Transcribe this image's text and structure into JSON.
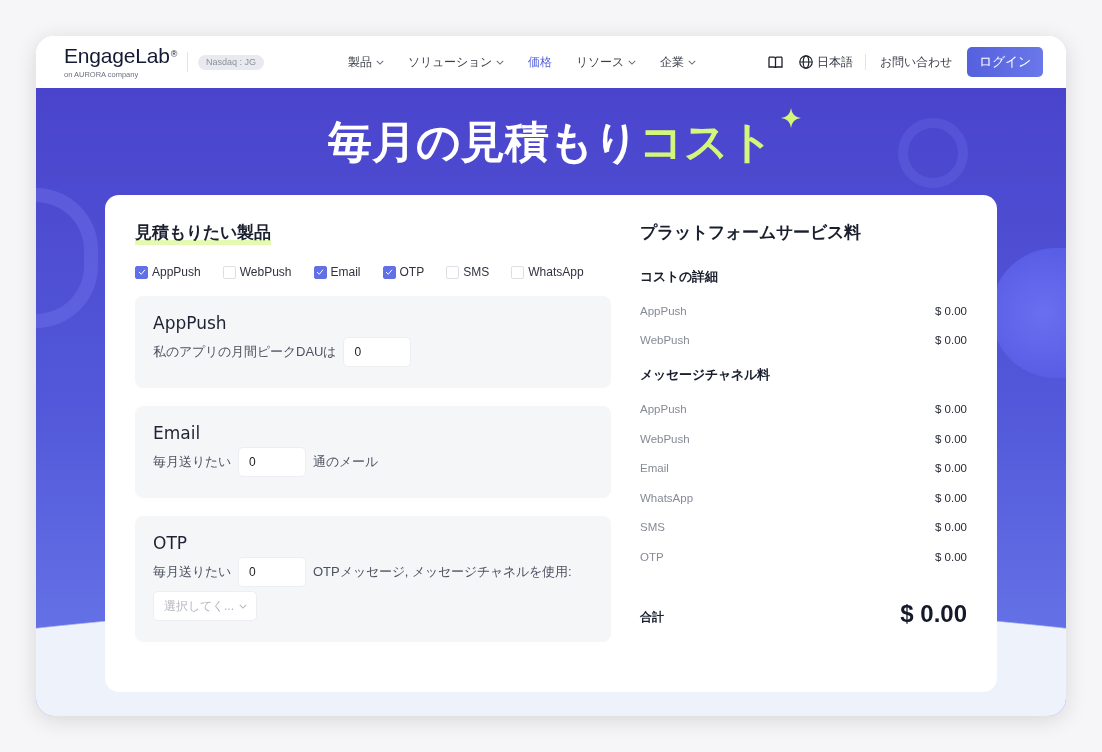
{
  "header": {
    "logo": {
      "wordmark": "EngageLab$^{®}$",
      "tagline": "on AURORA company"
    },
    "stock_badge": "Nasdaq : JG",
    "nav": [
      {
        "label": "製品",
        "dropdown": true,
        "selected": false
      },
      {
        "label": "ソリューション",
        "dropdown": true,
        "selected": false
      },
      {
        "label": "価格",
        "dropdown": false,
        "selected": true
      },
      {
        "label": "リソース",
        "dropdown": true,
        "selected": false
      },
      {
        "label": "企業",
        "dropdown": true,
        "selected": false
      }
    ],
    "language": "日本語",
    "contact": "お問い合わせ",
    "login": "ログイン"
  },
  "hero": {
    "title_parts": [
      {
        "text": "毎月の見積もり",
        "highlight": false
      },
      {
        "text": "コスト",
        "highlight": true
      }
    ]
  },
  "products": {
    "title": "見積もりたい製品",
    "options": [
      {
        "label": "AppPush",
        "checked": true
      },
      {
        "label": "WebPush",
        "checked": false
      },
      {
        "label": "Email",
        "checked": true
      },
      {
        "label": "OTP",
        "checked": true
      },
      {
        "label": "SMS",
        "checked": false
      },
      {
        "label": "WhatsApp",
        "checked": false
      }
    ],
    "panels": [
      {
        "title": "AppPush",
        "lines": [
          [
            {
              "kind": "text",
              "text": "私のアプリの月間ピークDAUは"
            },
            {
              "kind": "input",
              "value": "0"
            }
          ]
        ]
      },
      {
        "title": "Email",
        "lines": [
          [
            {
              "kind": "text",
              "text": "毎月送りたい"
            },
            {
              "kind": "input",
              "value": "0"
            },
            {
              "kind": "text",
              "text": "通のメール"
            }
          ]
        ]
      },
      {
        "title": "OTP",
        "lines": [
          [
            {
              "kind": "text",
              "text": "毎月送りたい"
            },
            {
              "kind": "input",
              "value": "0"
            },
            {
              "kind": "text",
              "text": "OTPメッセージ, メッセージチャネルを使用:"
            }
          ],
          [
            {
              "kind": "select",
              "placeholder": "選択してく..."
            }
          ]
        ]
      }
    ]
  },
  "summary": {
    "title": "プラットフォームサービス料",
    "sections": [
      {
        "heading": "コストの詳細",
        "items": [
          {
            "label": "AppPush",
            "amount": "$ 0.00"
          },
          {
            "label": "WebPush",
            "amount": "$ 0.00"
          }
        ]
      },
      {
        "heading": "メッセージチャネル料",
        "items": [
          {
            "label": "AppPush",
            "amount": "$ 0.00"
          },
          {
            "label": "WebPush",
            "amount": "$ 0.00"
          },
          {
            "label": "Email",
            "amount": "$ 0.00"
          },
          {
            "label": "WhatsApp",
            "amount": "$ 0.00"
          },
          {
            "label": "SMS",
            "amount": "$ 0.00"
          },
          {
            "label": "OTP",
            "amount": "$ 0.00"
          }
        ]
      }
    ],
    "total": {
      "label": "合計",
      "amount": "$ 0.00"
    }
  }
}
